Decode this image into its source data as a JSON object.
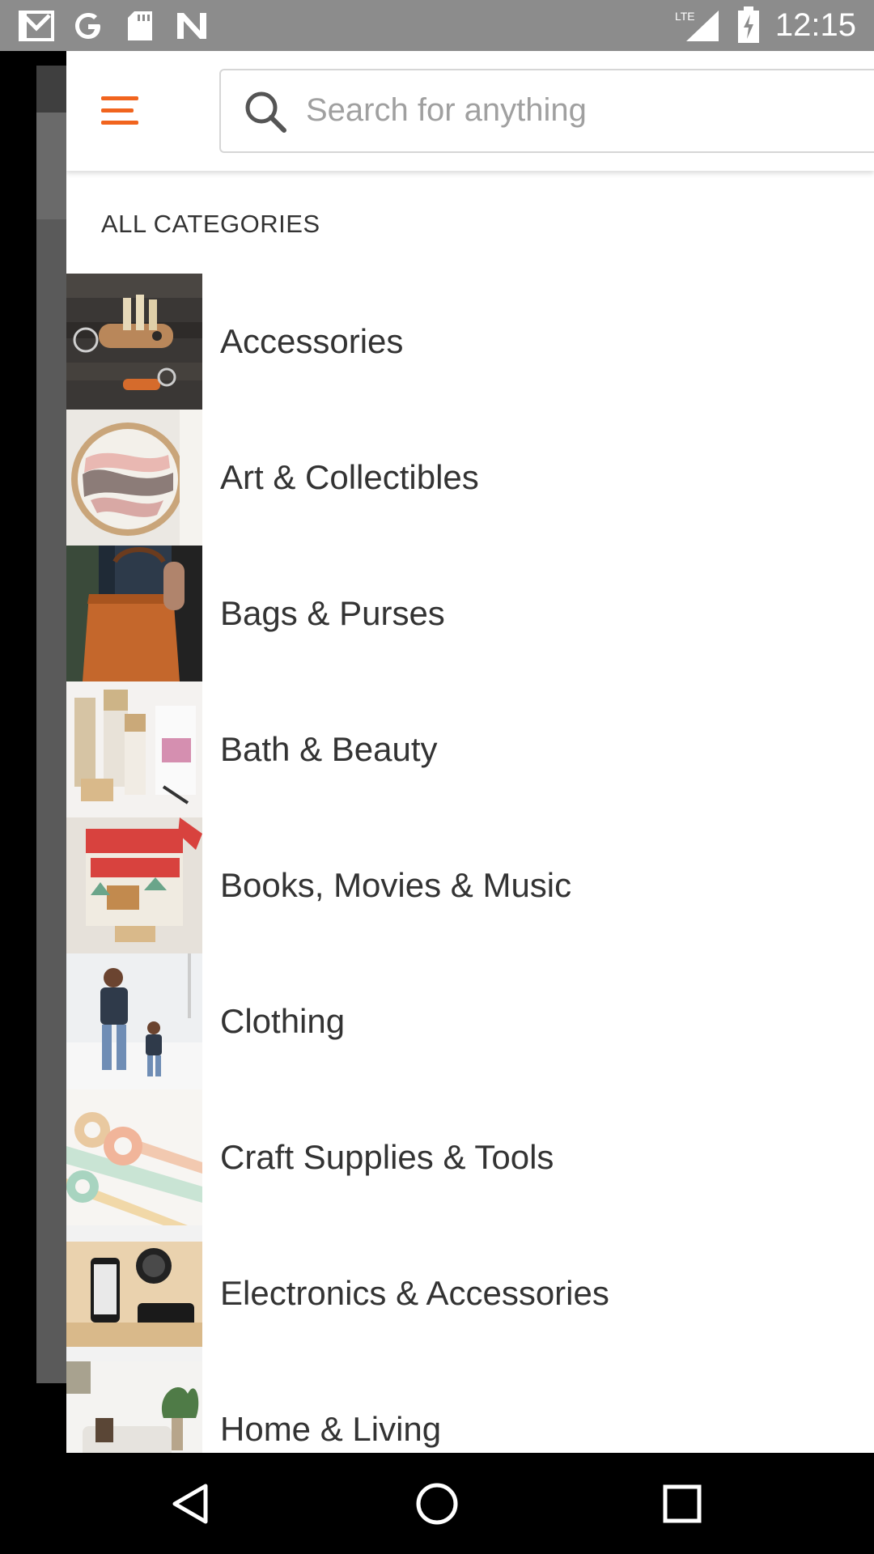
{
  "status_bar": {
    "time": "12:15",
    "left_icons": [
      "gmail-icon",
      "google-icon",
      "sd-card-icon",
      "n-app-icon"
    ],
    "right_icons": [
      "lte-signal-icon",
      "battery-charging-icon"
    ],
    "network_label": "LTE"
  },
  "header": {
    "menu_icon": "hamburger-menu-icon",
    "search": {
      "placeholder": "Search for anything",
      "icon": "search-icon"
    }
  },
  "drawer": {
    "section_title": "ALL CATEGORIES",
    "categories": [
      {
        "label": "Accessories",
        "thumbnail": "keychain-photo"
      },
      {
        "label": "Art & Collectibles",
        "thumbnail": "embroidery-hoop-photo"
      },
      {
        "label": "Bags & Purses",
        "thumbnail": "leather-tote-photo"
      },
      {
        "label": "Bath & Beauty",
        "thumbnail": "cosmetic-bottles-photo"
      },
      {
        "label": "Books, Movies & Music",
        "thumbnail": "michigan-postcard-photo"
      },
      {
        "label": "Clothing",
        "thumbnail": "father-son-shirts-photo"
      },
      {
        "label": "Craft Supplies & Tools",
        "thumbnail": "washi-tape-photo"
      },
      {
        "label": "Electronics & Accessories",
        "thumbnail": "phone-dock-photo"
      },
      {
        "label": "Home & Living",
        "thumbnail": "living-room-photo"
      }
    ]
  },
  "colors": {
    "accent": "#F1641E",
    "status_bar": "#8C8C8C",
    "text": "#333333",
    "placeholder": "#A0A0A0"
  },
  "nav_bar": {
    "buttons": [
      "back-icon",
      "home-icon",
      "recents-icon"
    ]
  }
}
